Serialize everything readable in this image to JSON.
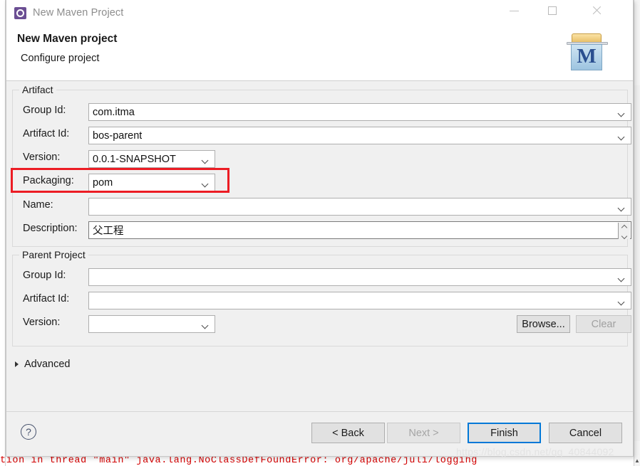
{
  "window": {
    "title": "New Maven Project",
    "icon": "maven-wizard-icon",
    "controls": {
      "minimize": "minimize-icon",
      "maximize": "maximize-icon",
      "close": "close-icon"
    }
  },
  "header": {
    "title": "New Maven project",
    "subtitle": "Configure project",
    "banner_icon_letter": "M"
  },
  "artifact": {
    "legend": "Artifact",
    "fields": [
      {
        "label": "Group Id:",
        "value": "com.itma",
        "control": "combo-wide"
      },
      {
        "label": "Artifact Id:",
        "value": "bos-parent",
        "control": "combo-wide"
      },
      {
        "label": "Version:",
        "value": "0.0.1-SNAPSHOT",
        "control": "combo-short"
      },
      {
        "label": "Packaging:",
        "value": "pom",
        "control": "combo-short"
      },
      {
        "label": "Name:",
        "value": "",
        "control": "combo-wide"
      },
      {
        "label": "Description:",
        "value": "父工程",
        "control": "text-spinner"
      }
    ]
  },
  "parent_project": {
    "legend": "Parent Project",
    "fields": [
      {
        "label": "Group Id:",
        "value": "",
        "control": "combo-wide"
      },
      {
        "label": "Artifact Id:",
        "value": "",
        "control": "combo-wide"
      },
      {
        "label": "Version:",
        "value": "",
        "control": "combo-short"
      }
    ],
    "browse_label": "Browse...",
    "clear_label": "Clear",
    "clear_disabled": true
  },
  "advanced": {
    "label": "Advanced",
    "expanded": false
  },
  "footer": {
    "help_glyph": "?",
    "buttons": [
      {
        "label": "< Back",
        "state": "enabled"
      },
      {
        "label": "Next >",
        "state": "disabled"
      },
      {
        "label": "Finish",
        "state": "default"
      },
      {
        "label": "Cancel",
        "state": "enabled"
      }
    ]
  },
  "annotation": {
    "highlight_target": "Packaging:",
    "color": "#ec1c24"
  },
  "background": {
    "console_text": "tion in thread \"main\" java.lang.NoClassDefFoundError: org/apache/juli/logging",
    "console_color": "#d40000",
    "watermark": "https://blog.csdn.net/qq_40844092"
  }
}
